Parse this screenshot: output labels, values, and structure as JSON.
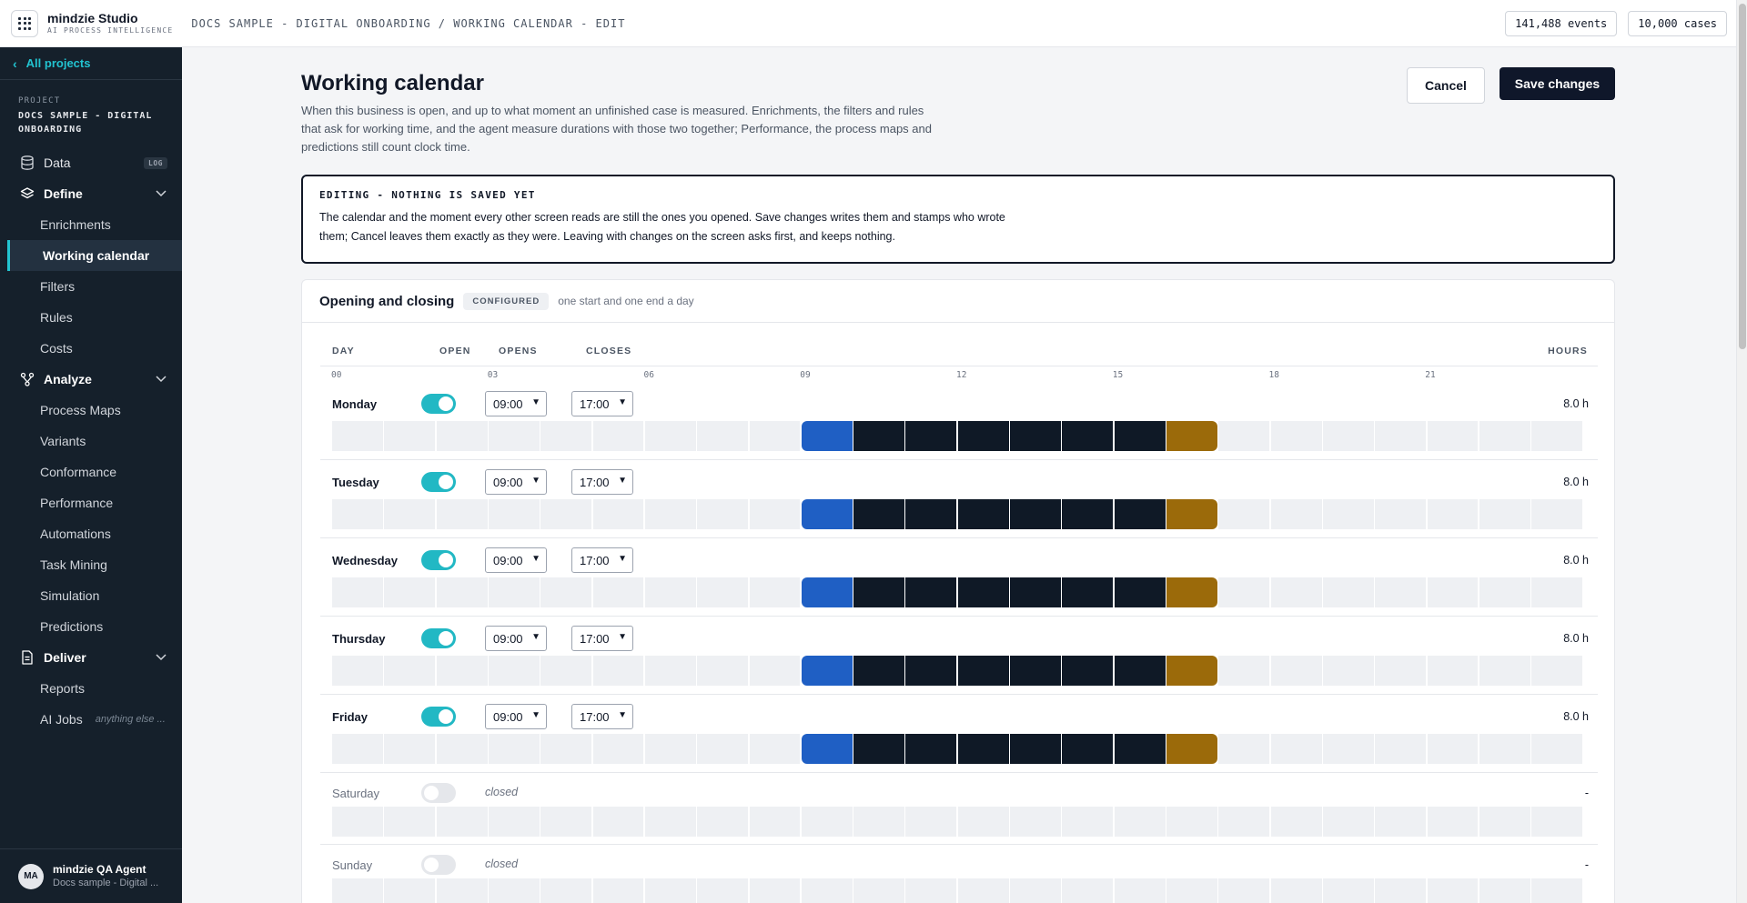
{
  "topbar": {
    "brand_name": "mindzie Studio",
    "brand_tag": "AI PROCESS INTELLIGENCE",
    "breadcrumb": "DOCS SAMPLE - DIGITAL ONBOARDING / WORKING CALENDAR - EDIT",
    "events": "141,488 events",
    "cases": "10,000 cases"
  },
  "sidebar": {
    "all_projects": "All projects",
    "project_label": "PROJECT",
    "project_name": "DOCS SAMPLE - DIGITAL ONBOARDING",
    "data": {
      "label": "Data",
      "badge": "LOG"
    },
    "define": {
      "label": "Define",
      "items": [
        "Enrichments",
        "Working calendar",
        "Filters",
        "Rules",
        "Costs"
      ]
    },
    "analyze": {
      "label": "Analyze",
      "items": [
        "Process Maps",
        "Variants",
        "Conformance",
        "Performance",
        "Automations",
        "Task Mining",
        "Simulation",
        "Predictions"
      ]
    },
    "deliver": {
      "label": "Deliver",
      "items": [
        "Reports",
        "AI Jobs"
      ],
      "ai_jobs_hint": "anything else ..."
    },
    "user": {
      "initials": "MA",
      "name": "mindzie QA Agent",
      "project": "Docs sample - Digital ..."
    }
  },
  "page": {
    "title": "Working calendar",
    "description": "When this business is open, and up to what moment an unfinished case is measured. Enrichments, the filters and rules that ask for working time, and the agent measure durations with those two together; Performance, the process maps and predictions still count clock time.",
    "cancel_label": "Cancel",
    "save_label": "Save changes"
  },
  "notice": {
    "title": "EDITING - NOTHING IS SAVED YET",
    "body": "The calendar and the moment every other screen reads are still the ones you opened. Save changes writes them and stamps who wrote them; Cancel leaves them exactly as they were. Leaving with changes on the screen asks first, and keeps nothing."
  },
  "card": {
    "title": "Opening and closing",
    "status": "CONFIGURED",
    "note": "one start and one end a day",
    "columns": {
      "day": "DAY",
      "open": "OPEN",
      "opens": "OPENS",
      "closes": "CLOSES",
      "hours": "HOURS"
    },
    "ticks": [
      "00",
      "03",
      "06",
      "09",
      "12",
      "15",
      "18",
      "21"
    ],
    "closed_label": "closed",
    "days": [
      {
        "name": "Monday",
        "open": true,
        "opens": "09:00",
        "closes": "17:00",
        "hours": "8.0 h"
      },
      {
        "name": "Tuesday",
        "open": true,
        "opens": "09:00",
        "closes": "17:00",
        "hours": "8.0 h"
      },
      {
        "name": "Wednesday",
        "open": true,
        "opens": "09:00",
        "closes": "17:00",
        "hours": "8.0 h"
      },
      {
        "name": "Thursday",
        "open": true,
        "opens": "09:00",
        "closes": "17:00",
        "hours": "8.0 h"
      },
      {
        "name": "Friday",
        "open": true,
        "opens": "09:00",
        "closes": "17:00",
        "hours": "8.0 h"
      },
      {
        "name": "Saturday",
        "open": false,
        "hours": "-"
      },
      {
        "name": "Sunday",
        "open": false,
        "hours": "-"
      }
    ]
  },
  "colors": {
    "accent": "#22b8c4",
    "open_hour": "#1f5fc4",
    "work_hour": "#0f1926",
    "close_hour": "#9b6a0a",
    "empty_hour": "#eef0f3"
  }
}
